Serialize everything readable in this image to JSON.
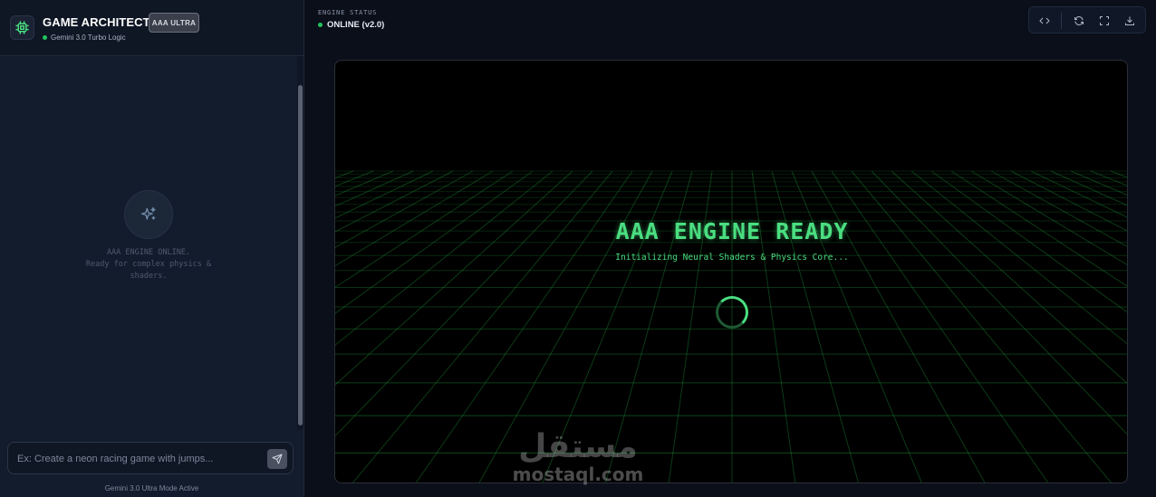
{
  "sidebar": {
    "app_title": "GAME ARCHITECT",
    "tier_badge": "AAA ULTRA",
    "subtitle": "Gemini 3.0 Turbo Logic",
    "empty_state": {
      "icon": "sparkles-icon",
      "line1": "AAA ENGINE ONLINE.",
      "line2": "Ready for complex physics &",
      "line3": "shaders."
    },
    "chat_input": {
      "value": "",
      "placeholder": "Ex: Create a neon racing game with jumps..."
    },
    "send_icon": "send-icon",
    "footer": "Gemini 3.0 Ultra Mode Active"
  },
  "header": {
    "status_label": "ENGINE STATUS",
    "status_value": "ONLINE (v2.0)",
    "toolbar": [
      "code-icon",
      "refresh-icon",
      "fullscreen-icon",
      "download-icon"
    ]
  },
  "viewport": {
    "title": "AAA ENGINE READY",
    "subtitle": "Initializing Neural Shaders & Physics Core..."
  },
  "watermark": {
    "arabic": "مستقل",
    "latin": "mostaql.com"
  },
  "colors": {
    "accent_green": "#4ade80",
    "status_green": "#22c55e",
    "sidebar_bg": "#131c2c",
    "app_bg": "#0a0f1a"
  }
}
